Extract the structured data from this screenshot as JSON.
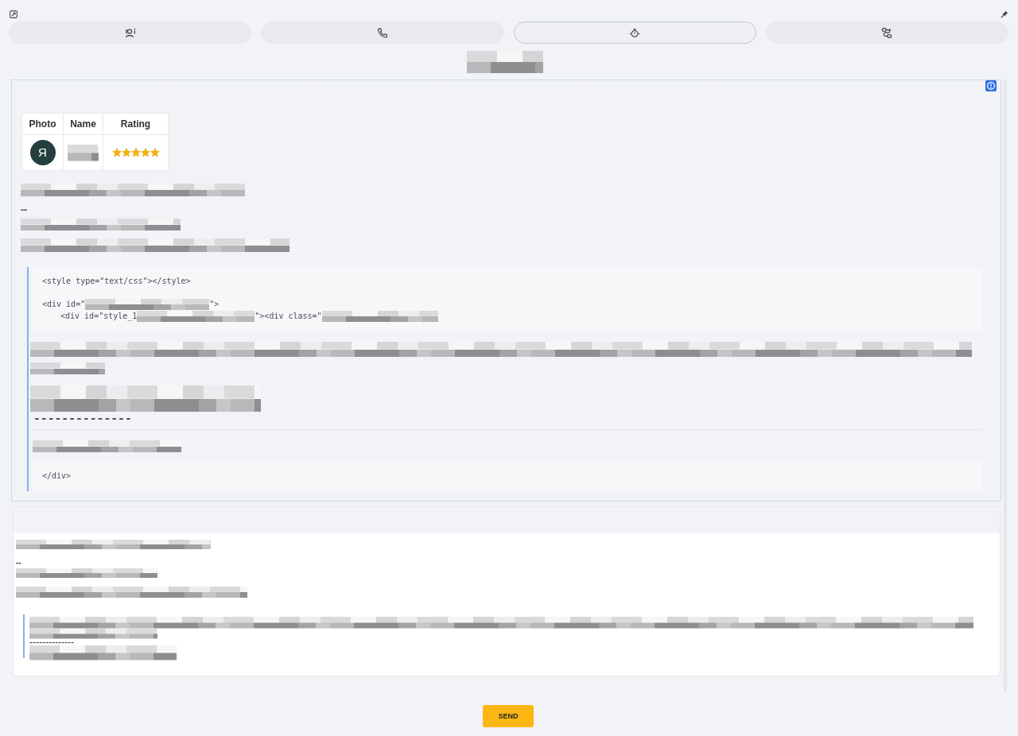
{
  "toolbar": {
    "tabs": [
      {
        "kind": "contact",
        "selected": false
      },
      {
        "kind": "phone",
        "selected": false
      },
      {
        "kind": "timer",
        "selected": true
      },
      {
        "kind": "flow",
        "selected": false
      }
    ]
  },
  "preview": {
    "table": {
      "columns": [
        "Photo",
        "Name",
        "Rating"
      ],
      "rows": [
        {
          "avatar": "Я",
          "stars": 5
        }
      ]
    },
    "separator": "--",
    "code_top": [
      {
        "indented": false,
        "parts": [
          {
            "kind": "text",
            "text": "<style type=\"text/css\"></style>"
          }
        ]
      },
      {
        "indented": false,
        "parts": [
          {
            "kind": "text",
            "text": "<div id=\""
          },
          {
            "kind": "pixelated"
          },
          {
            "kind": "text",
            "text": "\">"
          }
        ]
      },
      {
        "indented": true,
        "parts": [
          {
            "kind": "text",
            "text": "<div id=\"style_1"
          },
          {
            "kind": "pixelated"
          },
          {
            "kind": "text",
            "text": "\"><div class=\""
          },
          {
            "kind": "pixelated"
          }
        ]
      }
    ],
    "dashes": "--------------",
    "code_bottom": "</div>"
  },
  "reply": {
    "separator": "--",
    "dashes": "--------------"
  },
  "send_button": "SEND"
}
